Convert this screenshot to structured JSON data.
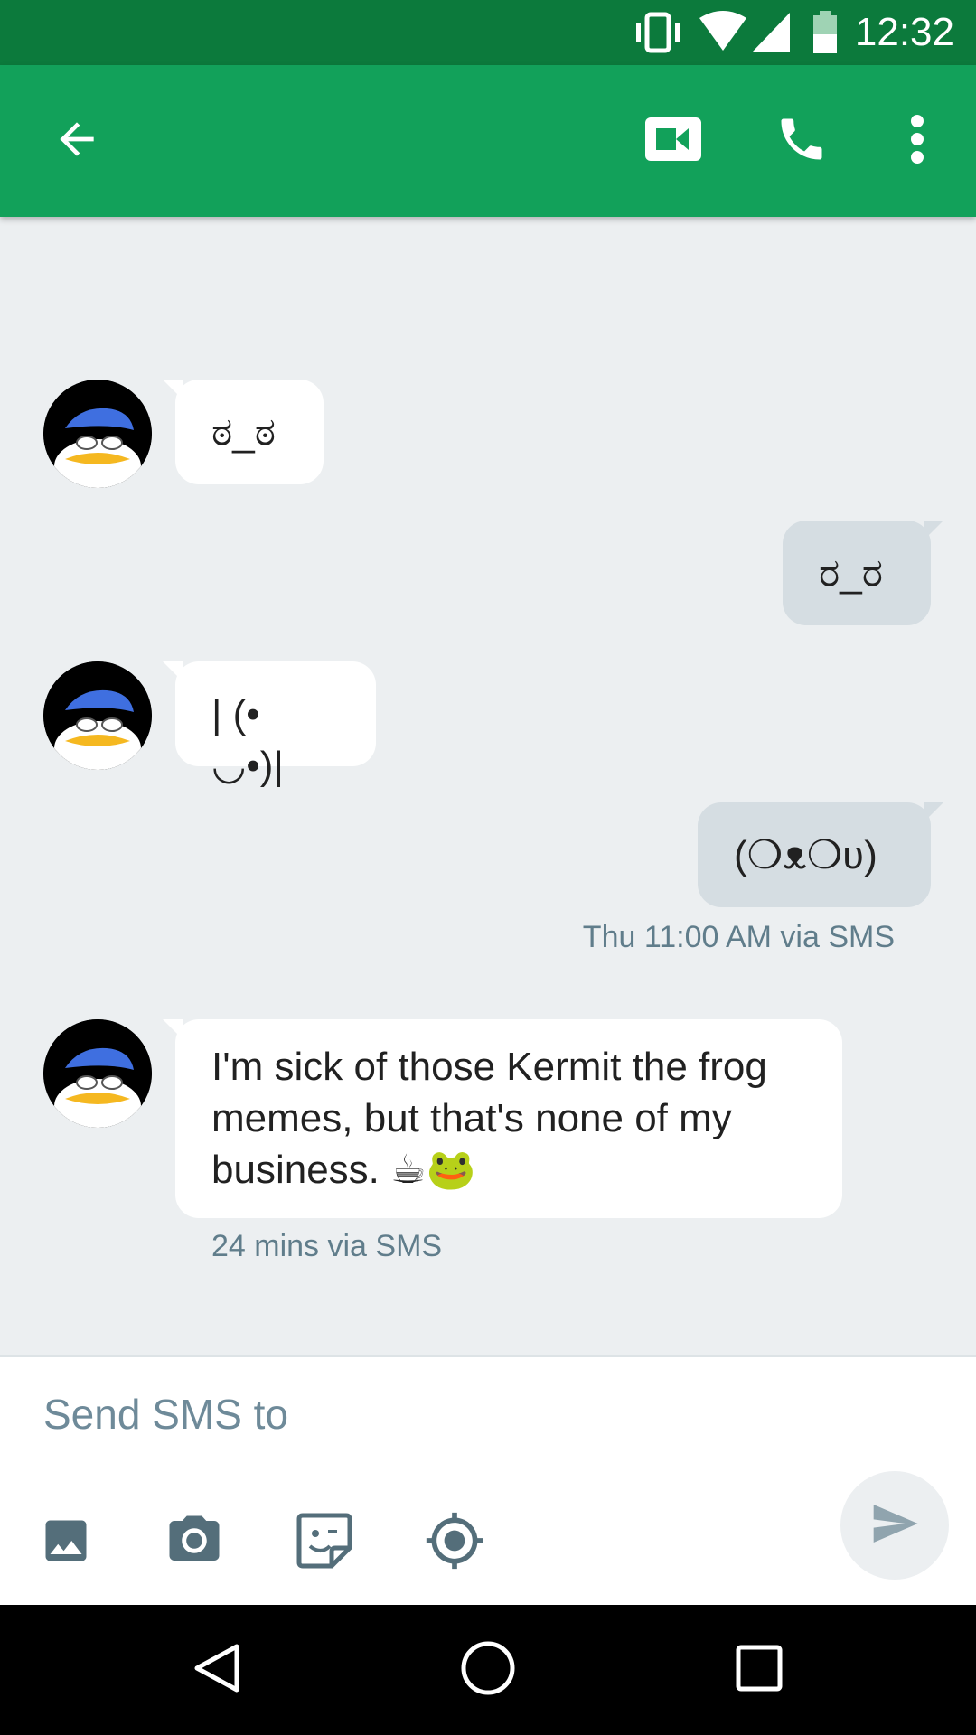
{
  "status_bar": {
    "time": "12:32",
    "icons": [
      "vibrate-icon",
      "wifi-icon",
      "cell-signal-icon",
      "battery-icon"
    ]
  },
  "app_bar": {
    "icons": [
      "back-arrow-icon",
      "video-call-icon",
      "phone-icon",
      "overflow-menu-icon"
    ],
    "color": "#12a15a"
  },
  "messages": [
    {
      "direction": "in",
      "text": "ಠ_ಠ"
    },
    {
      "direction": "out",
      "text": "ರ_ರ"
    },
    {
      "direction": "in",
      "text": "| (• ◡•)|"
    },
    {
      "direction": "out",
      "text": "(❍ᴥ❍ʋ)"
    },
    {
      "direction": "in",
      "text": "I'm sick of those Kermit the frog memes, but that's none of my business. ☕🐸"
    }
  ],
  "timestamps": {
    "out_2": "Thu 11:00 AM via SMS",
    "in_3": "24 mins via SMS"
  },
  "compose": {
    "placeholder": "Send SMS to",
    "tools": [
      "gallery-icon",
      "camera-icon",
      "sticker-icon",
      "location-icon"
    ],
    "send_icon": "send-icon"
  },
  "nav_bar": {
    "icons": [
      "back-triangle-icon",
      "home-circle-icon",
      "recents-square-icon"
    ]
  }
}
